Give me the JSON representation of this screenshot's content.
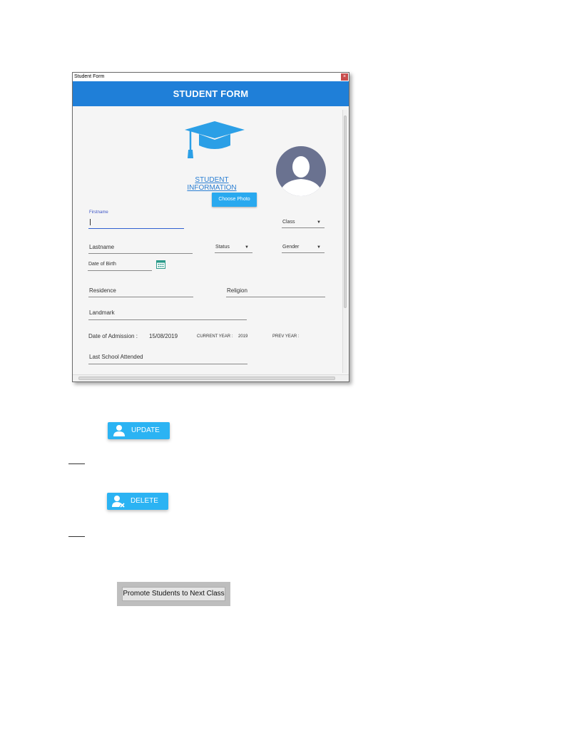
{
  "window": {
    "title": "Student Form",
    "close_label": "×",
    "header": "STUDENT FORM"
  },
  "form": {
    "info_link": "STUDENT INFORMATION",
    "choose_photo": "Choose Photo",
    "firstname_label": "Firstname",
    "firstname_value": "",
    "class_label": "Class",
    "lastname_label": "Lastname",
    "status_label": "Status",
    "gender_label": "Gender",
    "dob_label": "Date of Birth",
    "residence_label": "Residence",
    "religion_label": "Religion",
    "landmark_label": "Landmark",
    "admission_label": "Date of Admission :",
    "admission_value": "15/08/2019",
    "current_year_label": "CURRENT YEAR :",
    "current_year_value": "2019",
    "prev_year_label": "PREV YEAR :",
    "last_school_label": "Last School Attended",
    "dropdown_arrow": "▼"
  },
  "actions": {
    "update_label": "UPDATE",
    "delete_label": "DELETE",
    "promote_label": "Promote Students to Next Class"
  },
  "colors": {
    "header_blue": "#1f7fd8",
    "button_blue": "#2bb3f3",
    "link_blue": "#2b7fd3",
    "avatar_bg": "#6a7290"
  },
  "icons": [
    "graduation-cap-icon",
    "avatar-silhouette-icon",
    "calendar-icon",
    "user-icon",
    "user-remove-icon"
  ]
}
